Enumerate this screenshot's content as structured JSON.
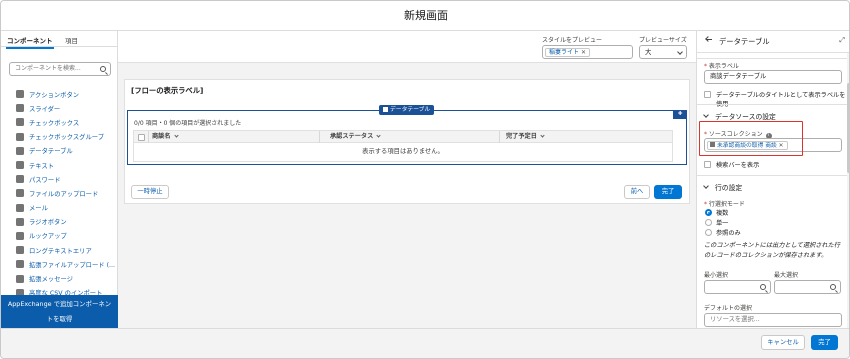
{
  "modal": {
    "title": "新規画面"
  },
  "left": {
    "tabs": [
      "コンポーネント",
      "項目"
    ],
    "search_placeholder": "コンポーネントを検索...",
    "components": [
      "アクションボタン",
      "スライダー",
      "チェックボックス",
      "チェックボックスグループ",
      "データテーブル",
      "テキスト",
      "パスワード",
      "ファイルのアップロード",
      "メール",
      "ラジオボタン",
      "ルックアップ",
      "ロングテキストエリア",
      "拡張ファイルアップロード (...",
      "拡張メッセージ",
      "高度な CSV のインポート"
    ],
    "appexchange_line1": "AppExchange で追加コンポーネン",
    "appexchange_line2": "トを取得"
  },
  "preview": {
    "style_label": "スタイルをプレビュー",
    "style_value": "稲妻ライト",
    "size_label": "プレビューサイズ",
    "size_value": "大"
  },
  "canvas": {
    "flow_label": "[フローの表示ラベル]",
    "datatable_badge": "データテーブル",
    "selection_info": "0/0 項目・0 個の項目が選択されました",
    "columns": [
      "商談名",
      "承認ステータス",
      "完了予定日"
    ],
    "empty_message": "表示する項目はありません。",
    "pause_button": "一時停止",
    "prev_button": "前へ",
    "finish_button": "完了"
  },
  "properties": {
    "title": "データテーブル",
    "display_label_label": "表示ラベル",
    "display_label_value": "商談データテーブル",
    "use_as_title_label": "データテーブルのタイトルとして表示ラベルを使用",
    "datasource_section": "データソースの設定",
    "source_collection_label": "ソースコレクション",
    "source_collection_value": "未承認商談の取得 商談",
    "show_search_label": "検索バーを表示",
    "row_section": "行の設定",
    "row_selection_mode_label": "行選択モード",
    "row_modes": [
      "複数",
      "単一",
      "参照のみ"
    ],
    "output_note": "このコンポーネントには出力として選択された行のレコードのコレクションが保存されます。",
    "min_select_label": "最小選択",
    "max_select_label": "最大選択",
    "default_select_label": "デフォルトの選択",
    "resource_placeholder": "リソースを選択..."
  },
  "footer": {
    "cancel_button": "キャンセル",
    "done_button": "完了"
  },
  "colors": {
    "brand_blue": "#0176d3",
    "link_blue": "#0b5cab",
    "datatable_frame": "#1b5297",
    "highlight_red": "#d9352a"
  }
}
